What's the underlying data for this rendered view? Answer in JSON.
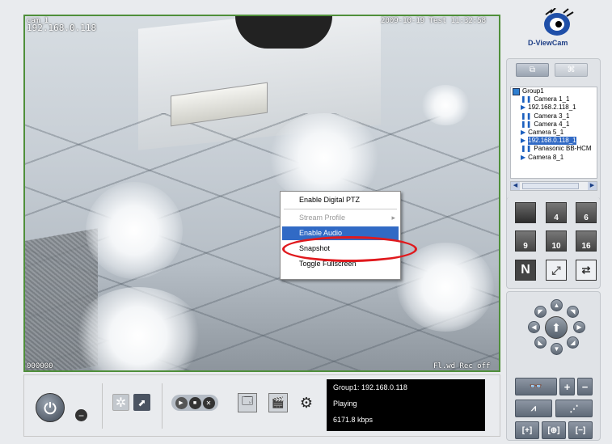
{
  "video": {
    "ip_overlay": "192.168.0.118",
    "name_overlay": "cam_1",
    "time_overlay": "2009-10-19 Test 11:32:58",
    "bottom_left": "000000",
    "bottom_right": "Fl.wd Rec off"
  },
  "context_menu": {
    "items": [
      {
        "label": "Enable Digital PTZ",
        "state": "normal"
      },
      {
        "label": "Stream Profile",
        "state": "disabled"
      },
      {
        "label": "Enable Audio",
        "state": "selected"
      },
      {
        "label": "Snapshot",
        "state": "normal"
      },
      {
        "label": "Toggle Fullscreen",
        "state": "normal"
      }
    ]
  },
  "status": {
    "line1": "Group1: 192.168.0.118",
    "line2": "Playing",
    "line3": "6171.8 kbps"
  },
  "brand": {
    "name": "D-ViewCam"
  },
  "tree": {
    "group": "Group1",
    "cameras": [
      "Camera 1_1",
      "192.168.2.118_1",
      "Camera 3_1",
      "Camera 4_1",
      "Camera 5_1",
      "192.168.0.118_1",
      "Panasonic BB-HCM",
      "Camera 8_1"
    ],
    "selected_index": 5
  },
  "layouts": [
    "1",
    "4",
    "6",
    "9",
    "10",
    "16",
    "N"
  ],
  "colors": {
    "accent": "#316ac5",
    "frame": "#4f8f3a",
    "highlight": "#e0191d"
  }
}
